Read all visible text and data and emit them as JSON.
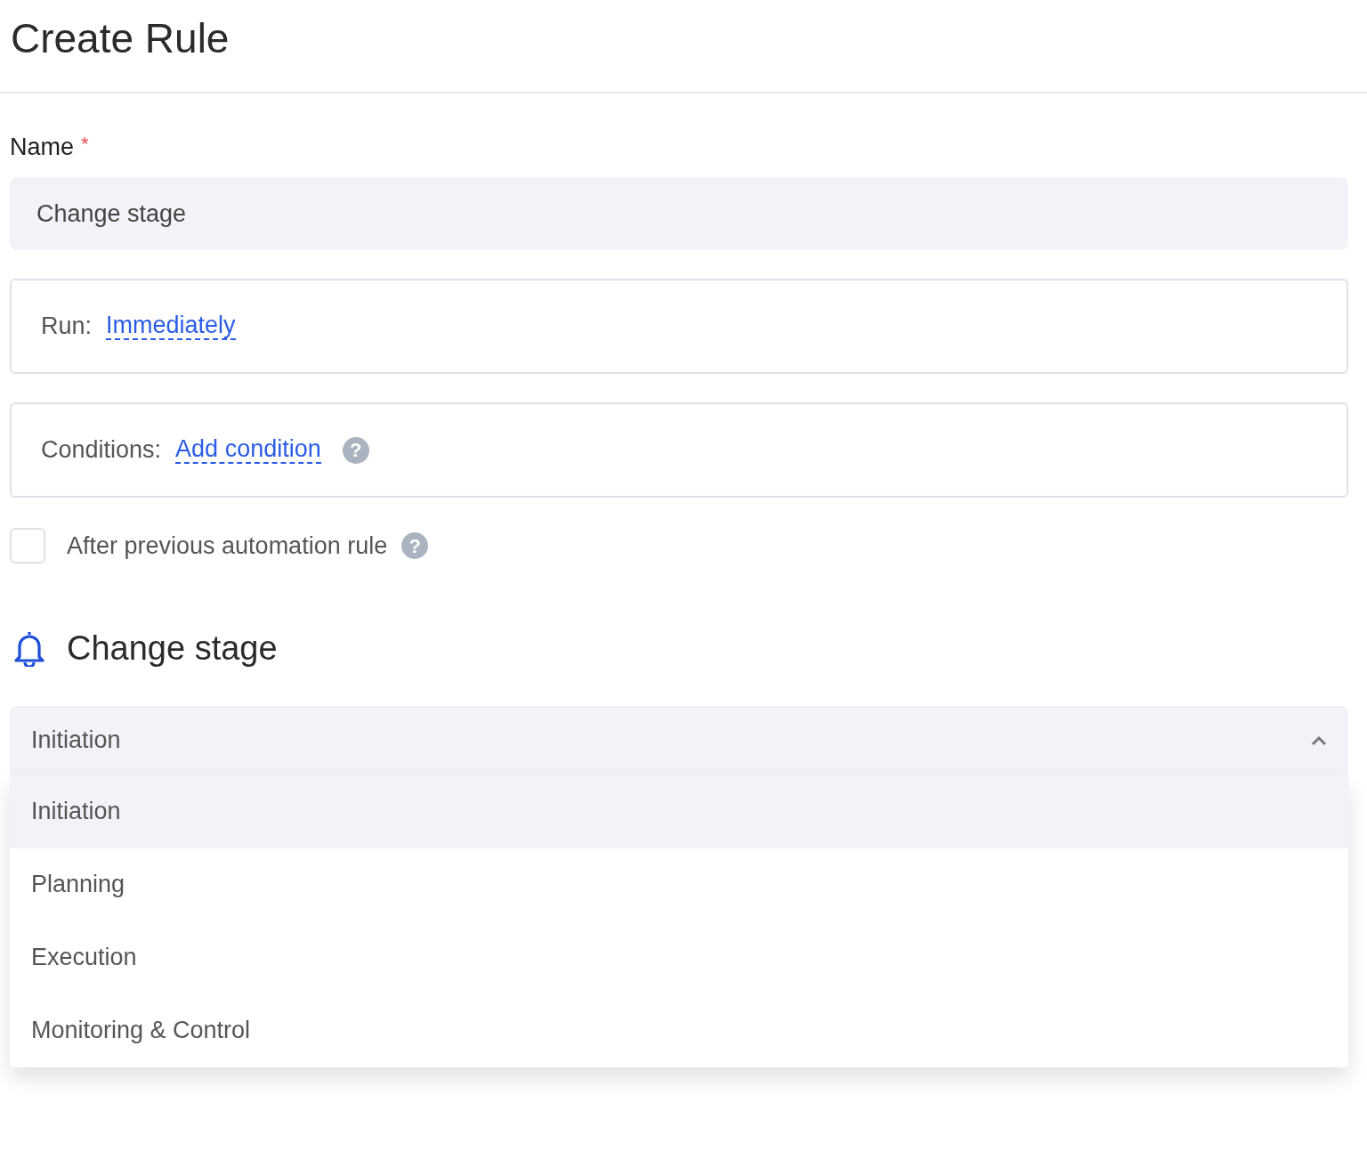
{
  "page": {
    "title": "Create Rule"
  },
  "name_field": {
    "label": "Name",
    "required_mark": "*",
    "value": "Change stage"
  },
  "run": {
    "label": "Run:",
    "link": "Immediately"
  },
  "conditions": {
    "label": "Conditions:",
    "link": "Add condition",
    "help_mark": "?"
  },
  "after_previous": {
    "label": "After previous automation rule",
    "help_mark": "?",
    "checked": false
  },
  "action": {
    "title": "Change stage"
  },
  "stage_select": {
    "value": "Initiation",
    "expanded": true,
    "options": [
      {
        "label": "Initiation",
        "selected": true
      },
      {
        "label": "Planning",
        "selected": false
      },
      {
        "label": "Execution",
        "selected": false
      },
      {
        "label": "Monitoring & Control",
        "selected": false
      }
    ]
  }
}
